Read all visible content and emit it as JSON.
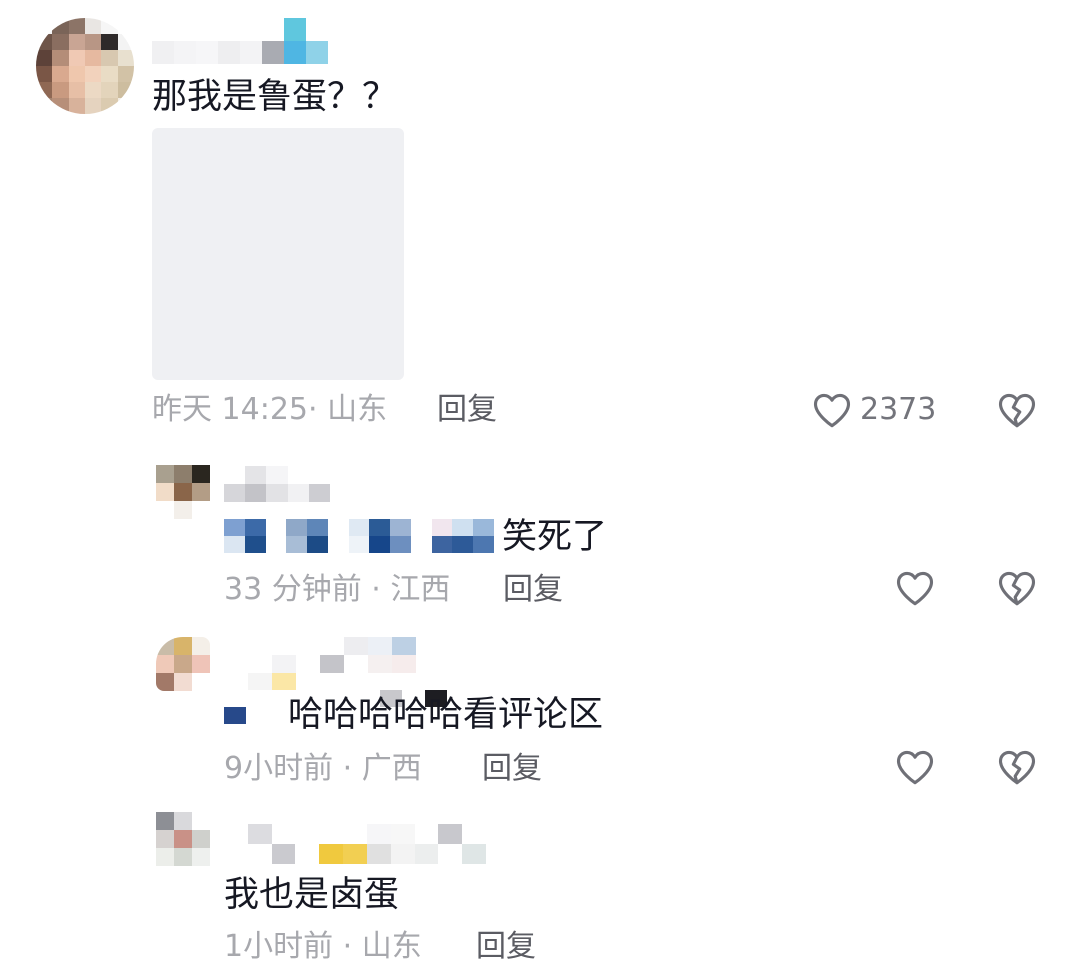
{
  "comments": [
    {
      "text": "那我是鲁蛋？？",
      "time_location": "昨天 14:25· 山东",
      "reply_label": "回复",
      "like_count": "2373"
    },
    {
      "text": "笑死了",
      "time_location": "33 分钟前 · 江西",
      "reply_label": "回复",
      "like_count": ""
    },
    {
      "text": "哈哈哈哈哈看评论区",
      "time_location": "9小时前 · 广西",
      "reply_label": "回复",
      "like_count": ""
    },
    {
      "text": "我也是卤蛋",
      "time_location": "1小时前 · 山东",
      "reply_label": "回复",
      "like_count": ""
    }
  ],
  "icons": {
    "like": "heart-outline-icon",
    "dislike": "broken-heart-icon"
  },
  "colors": {
    "text_primary": "#161823",
    "text_meta": "#a7a8ad",
    "reply": "#5b5c63",
    "icon_stroke": "#6f7077",
    "image_placeholder": "#eff0f3"
  }
}
